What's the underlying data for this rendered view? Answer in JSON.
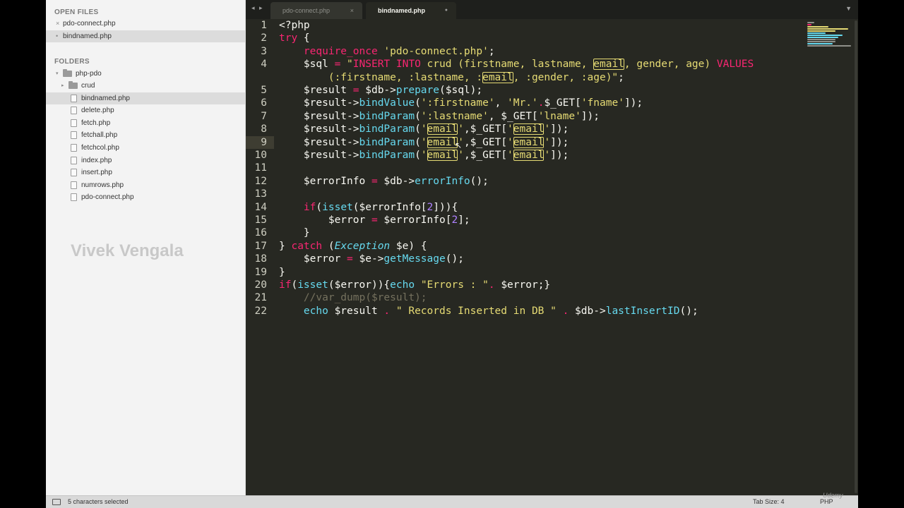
{
  "sidebar": {
    "open_files_heading": "OPEN FILES",
    "open_files": [
      {
        "label": "pdo-connect.php",
        "marker": "×"
      },
      {
        "label": "bindnamed.php",
        "marker": "•"
      }
    ],
    "folders_heading": "FOLDERS",
    "root_folder": "php-pdo",
    "subfolder": "crud",
    "files": [
      "bindnamed.php",
      "delete.php",
      "fetch.php",
      "fetchall.php",
      "fetchcol.php",
      "index.php",
      "insert.php",
      "numrows.php",
      "pdo-connect.php"
    ],
    "watermark": "Vivek Vengala"
  },
  "tabs": {
    "nav_back": "◂",
    "nav_forward": "▸",
    "items": [
      {
        "label": "pdo-connect.php",
        "close": "×"
      },
      {
        "label": "bindnamed.php",
        "close": "●"
      }
    ],
    "menu": "▼"
  },
  "editor": {
    "line_numbers": [
      "1",
      "2",
      "3",
      "4",
      "",
      "5",
      "6",
      "7",
      "8",
      "9",
      "10",
      "11",
      "12",
      "13",
      "14",
      "15",
      "16",
      "17",
      "18",
      "19",
      "20",
      "21",
      "22"
    ],
    "code": {
      "l1": "<?php",
      "l2_try": "try",
      "l2_rest": " {",
      "l3_kw": "require_once",
      "l3_str": "'pdo-connect.php'",
      "l3_end": ";",
      "l4_var": "$sql ",
      "l4_eq": "=",
      "l4_s1": " \"",
      "l4_insert": "INSERT INTO",
      "l4_s2": " crud (firstname, lastname, ",
      "l4_email": "email",
      "l4_s3": ", gender, age) ",
      "l4_values": "VALUES",
      "l4b_s1": "(:firstname, :lastname, :",
      "l4b_email": "email",
      "l4b_s2": ", :gender, :age)\"",
      "l4b_end": ";",
      "l5_a": "$result ",
      "l5_eq": "=",
      "l5_b": " $db->",
      "l5_fn": "prepare",
      "l5_c": "($sql);",
      "l6_a": "$result->",
      "l6_fn": "bindValue",
      "l6_b": "(",
      "l6_s1": "':firstname'",
      "l6_c": ", ",
      "l6_s2": "'Mr.'",
      "l6_dot": ".",
      "l6_d": "$_GET[",
      "l6_s3": "'fname'",
      "l6_e": "]);",
      "l7_a": "$result->",
      "l7_fn": "bindParam",
      "l7_b": "(",
      "l7_s1": "':lastname'",
      "l7_c": ", $_GET[",
      "l7_s2": "'lname'",
      "l7_d": "]);",
      "bp_a": "$result->",
      "bp_fn": "bindParam",
      "bp_b": "(",
      "bp_q": "'",
      "bp_email": "email",
      "bp_c": ",$_GET[",
      "bp_d": "]);",
      "l12_a": "$errorInfo ",
      "l12_eq": "=",
      "l12_b": " $db->",
      "l12_fn": "errorInfo",
      "l12_c": "();",
      "l14_if": "if",
      "l14_a": "(",
      "l14_fn": "isset",
      "l14_b": "($errorInfo[",
      "l14_num": "2",
      "l14_c": "])){",
      "l15_a": "$error ",
      "l15_eq": "=",
      "l15_b": " $errorInfo[",
      "l15_num": "2",
      "l15_c": "];",
      "l16": "}",
      "l17_a": "} ",
      "l17_catch": "catch",
      "l17_b": " (",
      "l17_cls": "Exception",
      "l17_c": " $e) {",
      "l18_a": "$error ",
      "l18_eq": "=",
      "l18_b": " $e->",
      "l18_fn": "getMessage",
      "l18_c": "();",
      "l19": "}",
      "l20_if": "if",
      "l20_a": "(",
      "l20_fn": "isset",
      "l20_b": "($error)){",
      "l20_echo": "echo",
      "l20_s": " \"Errors : \"",
      "l20_dot": ".",
      "l20_c": " $error;}",
      "l21": "//var_dump($result);",
      "l22_echo": "echo",
      "l22_a": " $result ",
      "l22_dot1": ".",
      "l22_s": " \" Records Inserted in DB \" ",
      "l22_dot2": ".",
      "l22_b": " $db->",
      "l22_fn": "lastInsertID",
      "l22_c": "();"
    }
  },
  "statusbar": {
    "selection": "5 characters selected",
    "tab_size": "Tab Size: 4",
    "syntax": "PHP"
  },
  "brand": "Udemy",
  "colors": {
    "background": "#272822",
    "keyword": "#f92672",
    "string": "#e6db74",
    "function": "#66d9ef",
    "number": "#ae81ff",
    "comment": "#75715e"
  }
}
